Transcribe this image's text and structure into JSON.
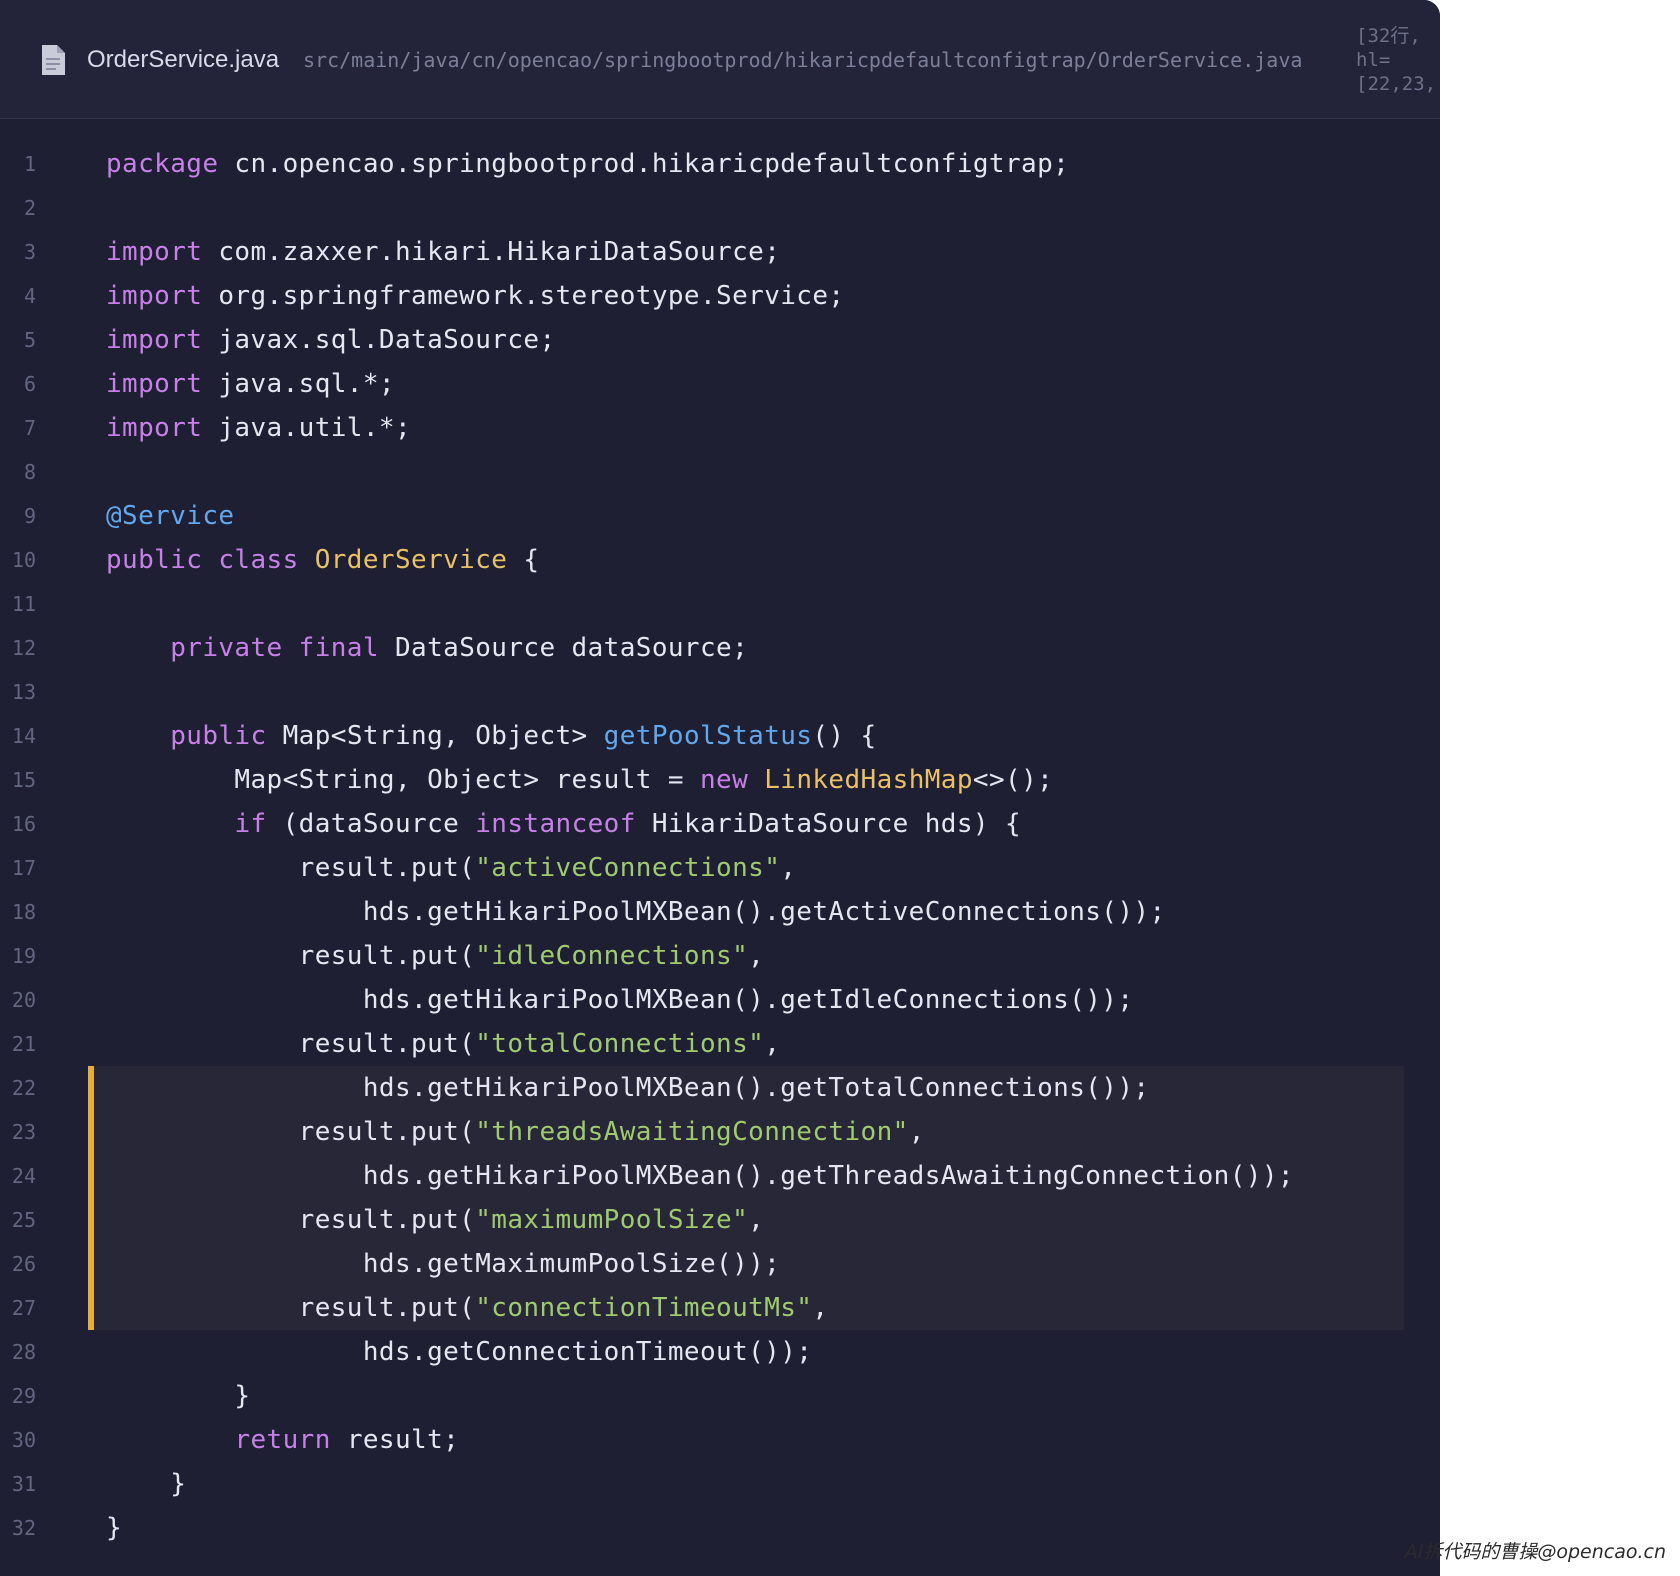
{
  "editor": {
    "file_icon": "document-icon",
    "file_name": "OrderService.java",
    "file_path": "src/main/java/cn/opencao/springbootprod/hikaricpdefaultconfigtrap/OrderService.java",
    "meta_lines": [
      "[32行, ",
      "hl=",
      "[22,23,"
    ],
    "highlighted_lines": [
      22,
      23,
      24,
      25,
      26,
      27
    ],
    "colors": {
      "background": "#1e1f33",
      "keyword": "#c780e8",
      "annotation": "#62a8ee",
      "type": "#e8c168",
      "method": "#62a8ee",
      "string": "#9ecb6f",
      "highlight_bar": "#e5b03a"
    }
  },
  "code_lines": [
    {
      "n": "1",
      "tokens": [
        {
          "t": "package",
          "c": "keyword"
        },
        {
          "t": " cn.opencao.springbootprod.hikaricpdefaultconfigtrap;",
          "c": "plain"
        }
      ]
    },
    {
      "n": "2",
      "tokens": []
    },
    {
      "n": "3",
      "tokens": [
        {
          "t": "import",
          "c": "keyword"
        },
        {
          "t": " com.zaxxer.hikari.HikariDataSource;",
          "c": "plain"
        }
      ]
    },
    {
      "n": "4",
      "tokens": [
        {
          "t": "import",
          "c": "keyword"
        },
        {
          "t": " org.springframework.stereotype.Service;",
          "c": "plain"
        }
      ]
    },
    {
      "n": "5",
      "tokens": [
        {
          "t": "import",
          "c": "keyword"
        },
        {
          "t": " javax.sql.DataSource;",
          "c": "plain"
        }
      ]
    },
    {
      "n": "6",
      "tokens": [
        {
          "t": "import",
          "c": "keyword"
        },
        {
          "t": " java.sql.*;",
          "c": "plain"
        }
      ]
    },
    {
      "n": "7",
      "tokens": [
        {
          "t": "import",
          "c": "keyword"
        },
        {
          "t": " java.util.*;",
          "c": "plain"
        }
      ]
    },
    {
      "n": "8",
      "tokens": []
    },
    {
      "n": "9",
      "tokens": [
        {
          "t": "@Service",
          "c": "annot"
        }
      ]
    },
    {
      "n": "10",
      "tokens": [
        {
          "t": "public class ",
          "c": "keyword"
        },
        {
          "t": "OrderService",
          "c": "type"
        },
        {
          "t": " {",
          "c": "plain"
        }
      ]
    },
    {
      "n": "11",
      "tokens": []
    },
    {
      "n": "12",
      "tokens": [
        {
          "t": "    ",
          "c": "plain"
        },
        {
          "t": "private final",
          "c": "keyword"
        },
        {
          "t": " DataSource dataSource;",
          "c": "plain"
        }
      ]
    },
    {
      "n": "13",
      "tokens": []
    },
    {
      "n": "14",
      "tokens": [
        {
          "t": "    ",
          "c": "plain"
        },
        {
          "t": "public",
          "c": "keyword"
        },
        {
          "t": " Map<String, Object> ",
          "c": "plain"
        },
        {
          "t": "getPoolStatus",
          "c": "method"
        },
        {
          "t": "() {",
          "c": "plain"
        }
      ]
    },
    {
      "n": "15",
      "tokens": [
        {
          "t": "        Map<String, Object> result = ",
          "c": "plain"
        },
        {
          "t": "new",
          "c": "keyword"
        },
        {
          "t": " ",
          "c": "plain"
        },
        {
          "t": "LinkedHashMap",
          "c": "type"
        },
        {
          "t": "<>();",
          "c": "plain"
        }
      ]
    },
    {
      "n": "16",
      "tokens": [
        {
          "t": "        ",
          "c": "plain"
        },
        {
          "t": "if",
          "c": "keyword"
        },
        {
          "t": " (dataSource ",
          "c": "plain"
        },
        {
          "t": "instanceof",
          "c": "keyword"
        },
        {
          "t": " HikariDataSource hds) {",
          "c": "plain"
        }
      ]
    },
    {
      "n": "17",
      "tokens": [
        {
          "t": "            result.put(",
          "c": "plain"
        },
        {
          "t": "\"activeConnections\"",
          "c": "string"
        },
        {
          "t": ",",
          "c": "plain"
        }
      ]
    },
    {
      "n": "18",
      "tokens": [
        {
          "t": "                hds.getHikariPoolMXBean().getActiveConnections());",
          "c": "plain"
        }
      ]
    },
    {
      "n": "19",
      "tokens": [
        {
          "t": "            result.put(",
          "c": "plain"
        },
        {
          "t": "\"idleConnections\"",
          "c": "string"
        },
        {
          "t": ",",
          "c": "plain"
        }
      ]
    },
    {
      "n": "20",
      "tokens": [
        {
          "t": "                hds.getHikariPoolMXBean().getIdleConnections());",
          "c": "plain"
        }
      ]
    },
    {
      "n": "21",
      "tokens": [
        {
          "t": "            result.put(",
          "c": "plain"
        },
        {
          "t": "\"totalConnections\"",
          "c": "string"
        },
        {
          "t": ",",
          "c": "plain"
        }
      ]
    },
    {
      "n": "22",
      "tokens": [
        {
          "t": "                hds.getHikariPoolMXBean().getTotalConnections());",
          "c": "plain"
        }
      ]
    },
    {
      "n": "23",
      "tokens": [
        {
          "t": "            result.put(",
          "c": "plain"
        },
        {
          "t": "\"threadsAwaitingConnection\"",
          "c": "string"
        },
        {
          "t": ",",
          "c": "plain"
        }
      ]
    },
    {
      "n": "24",
      "tokens": [
        {
          "t": "                hds.getHikariPoolMXBean().getThreadsAwaitingConnection());",
          "c": "plain"
        }
      ]
    },
    {
      "n": "25",
      "tokens": [
        {
          "t": "            result.put(",
          "c": "plain"
        },
        {
          "t": "\"maximumPoolSize\"",
          "c": "string"
        },
        {
          "t": ",",
          "c": "plain"
        }
      ]
    },
    {
      "n": "26",
      "tokens": [
        {
          "t": "                hds.getMaximumPoolSize());",
          "c": "plain"
        }
      ]
    },
    {
      "n": "27",
      "tokens": [
        {
          "t": "            result.put(",
          "c": "plain"
        },
        {
          "t": "\"connectionTimeoutMs\"",
          "c": "string"
        },
        {
          "t": ",",
          "c": "plain"
        }
      ]
    },
    {
      "n": "28",
      "tokens": [
        {
          "t": "                hds.getConnectionTimeout());",
          "c": "plain"
        }
      ]
    },
    {
      "n": "29",
      "tokens": [
        {
          "t": "        }",
          "c": "plain"
        }
      ]
    },
    {
      "n": "30",
      "tokens": [
        {
          "t": "        ",
          "c": "plain"
        },
        {
          "t": "return",
          "c": "keyword"
        },
        {
          "t": " result;",
          "c": "plain"
        }
      ]
    },
    {
      "n": "31",
      "tokens": [
        {
          "t": "    }",
          "c": "plain"
        }
      ]
    },
    {
      "n": "32",
      "tokens": [
        {
          "t": "}",
          "c": "plain"
        }
      ]
    }
  ],
  "watermark": "AI拆代码的曹操@opencao.cn"
}
